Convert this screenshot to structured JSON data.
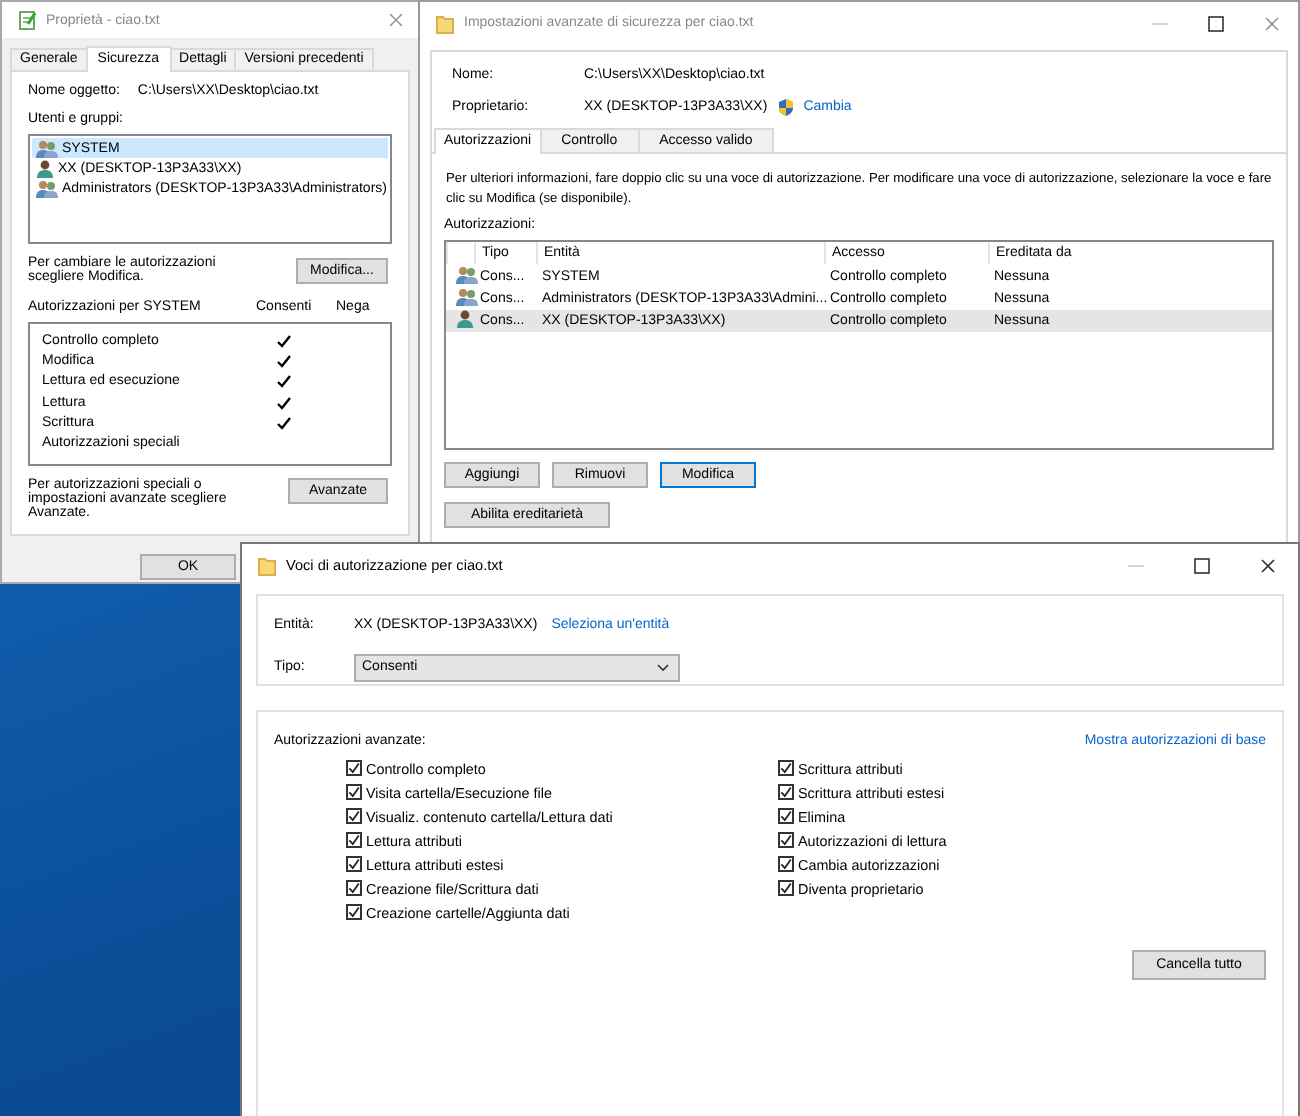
{
  "properties_window": {
    "title": "Proprietà - ciao.txt",
    "tabs": [
      {
        "label": "Generale",
        "selected": false
      },
      {
        "label": "Sicurezza",
        "selected": true
      },
      {
        "label": "Dettagli",
        "selected": false
      },
      {
        "label": "Versioni precedenti",
        "selected": false
      }
    ],
    "object_name_label": "Nome oggetto:",
    "object_name": "C:\\Users\\XX\\Desktop\\ciao.txt",
    "users_label": "Utenti e gruppi:",
    "users": [
      {
        "name": "SYSTEM",
        "kind": "group",
        "selected": true
      },
      {
        "name": "XX (DESKTOP-13P3A33\\XX)",
        "kind": "user",
        "selected": false
      },
      {
        "name": "Administrators (DESKTOP-13P3A33\\Administrators)",
        "kind": "group",
        "selected": false
      }
    ],
    "change_hint": "Per cambiare le autorizzazioni scegliere Modifica.",
    "edit_button": "Modifica...",
    "permissions_label": "Autorizzazioni per SYSTEM",
    "allow_label": "Consenti",
    "deny_label": "Nega",
    "permissions": [
      {
        "name": "Controllo completo",
        "allow": true,
        "deny": false
      },
      {
        "name": "Modifica",
        "allow": true,
        "deny": false
      },
      {
        "name": "Lettura ed esecuzione",
        "allow": true,
        "deny": false
      },
      {
        "name": "Lettura",
        "allow": true,
        "deny": false
      },
      {
        "name": "Scrittura",
        "allow": true,
        "deny": false
      },
      {
        "name": "Autorizzazioni speciali",
        "allow": false,
        "deny": false
      }
    ],
    "advanced_hint": "Per autorizzazioni speciali o impostazioni avanzate scegliere Avanzate.",
    "advanced_button": "Avanzate",
    "buttons": [
      "OK"
    ]
  },
  "advanced_window": {
    "title": "Impostazioni avanzate di sicurezza per ciao.txt",
    "name_label": "Nome:",
    "name": "C:\\Users\\XX\\Desktop\\ciao.txt",
    "owner_label": "Proprietario:",
    "owner": "XX (DESKTOP-13P3A33\\XX)",
    "change_link": "Cambia",
    "tabs": [
      {
        "label": "Autorizzazioni",
        "selected": true
      },
      {
        "label": "Controllo",
        "selected": false
      },
      {
        "label": "Accesso valido",
        "selected": false
      }
    ],
    "info": "Per ulteriori informazioni, fare doppio clic su una voce di autorizzazione. Per modificare una voce di autorizzazione, selezionare la voce e fare clic su Modifica (se disponibile).",
    "permissions_label": "Autorizzazioni:",
    "columns": [
      "Tipo",
      "Entità",
      "Accesso",
      "Ereditata da"
    ],
    "rows": [
      {
        "kind": "group",
        "type": "Cons...",
        "principal": "SYSTEM",
        "access": "Controllo completo",
        "inherited": "Nessuna",
        "selected": false
      },
      {
        "kind": "group",
        "type": "Cons...",
        "principal": "Administrators (DESKTOP-13P3A33\\Admini...",
        "access": "Controllo completo",
        "inherited": "Nessuna",
        "selected": false
      },
      {
        "kind": "user",
        "type": "Cons...",
        "principal": "XX (DESKTOP-13P3A33\\XX)",
        "access": "Controllo completo",
        "inherited": "Nessuna",
        "selected": true
      }
    ],
    "buttons": [
      {
        "label": "Aggiungi",
        "default": false
      },
      {
        "label": "Rimuovi",
        "default": false
      },
      {
        "label": "Modifica",
        "default": true
      }
    ],
    "inheritance_button": "Abilita ereditarietà"
  },
  "entry_window": {
    "title": "Voci di autorizzazione per ciao.txt",
    "principal_label": "Entità:",
    "principal": "XX (DESKTOP-13P3A33\\XX)",
    "select_link": "Seleziona un'entità",
    "type_label": "Tipo:",
    "type_value": "Consenti",
    "advanced_label": "Autorizzazioni avanzate:",
    "basic_link": "Mostra autorizzazioni di base",
    "left_permissions": [
      {
        "label": "Controllo completo",
        "checked": true
      },
      {
        "label": "Visita cartella/Esecuzione file",
        "checked": true
      },
      {
        "label": "Visualiz. contenuto cartella/Lettura dati",
        "checked": true
      },
      {
        "label": "Lettura attributi",
        "checked": true
      },
      {
        "label": "Lettura attributi estesi",
        "checked": true
      },
      {
        "label": "Creazione file/Scrittura dati",
        "checked": true
      },
      {
        "label": "Creazione cartelle/Aggiunta dati",
        "checked": true
      }
    ],
    "right_permissions": [
      {
        "label": "Scrittura attributi",
        "checked": true
      },
      {
        "label": "Scrittura attributi estesi",
        "checked": true
      },
      {
        "label": "Elimina",
        "checked": true
      },
      {
        "label": "Autorizzazioni di lettura",
        "checked": true
      },
      {
        "label": "Cambia autorizzazioni",
        "checked": true
      },
      {
        "label": "Diventa proprietario",
        "checked": true
      }
    ],
    "clear_button": "Cancella tutto"
  }
}
